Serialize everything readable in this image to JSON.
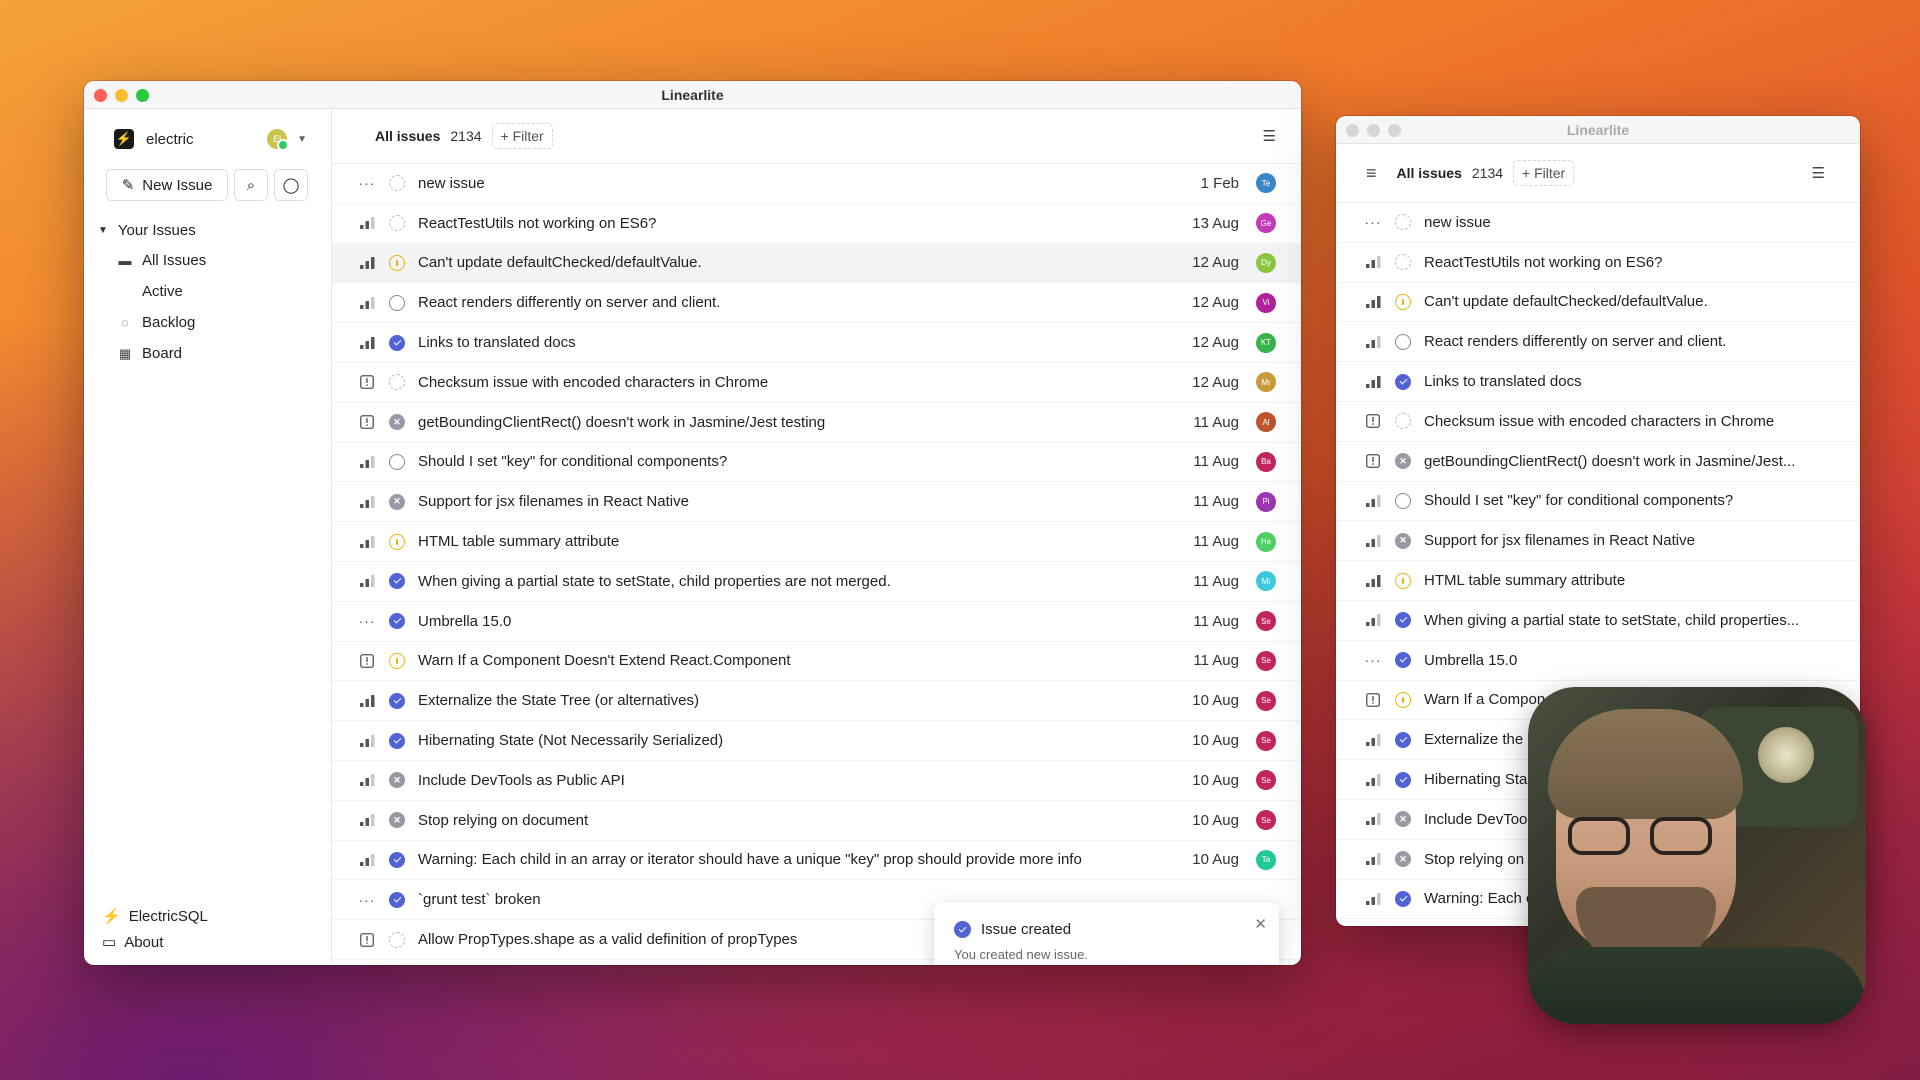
{
  "app_title": "Linearlite",
  "sidebar": {
    "workspace": "electric",
    "avatar_initials": "El",
    "new_issue": "New Issue",
    "group": "Your Issues",
    "items": [
      {
        "label": "All Issues",
        "icon": "inbox-icon"
      },
      {
        "label": "Active",
        "icon": ""
      },
      {
        "label": "Backlog",
        "icon": "backlog-circle-icon"
      },
      {
        "label": "Board",
        "icon": "grid-icon"
      }
    ],
    "footer": [
      {
        "label": "ElectricSQL",
        "icon": "bolt-icon"
      },
      {
        "label": "About",
        "icon": "info-icon"
      }
    ]
  },
  "topbar": {
    "title": "All issues",
    "count": "2134",
    "filter": "+ Filter"
  },
  "colors": {
    "done": "#5263d5",
    "in_progress": "#e8b40c",
    "canceled": "#9a9aa6"
  },
  "issues": [
    {
      "prio": "none",
      "status": "backlog",
      "title": "new issue",
      "date": "1 Feb",
      "avatar": "Te",
      "color": "#3a86c8"
    },
    {
      "prio": "med",
      "status": "backlog",
      "title": "ReactTestUtils not working on ES6?",
      "date": "13 Aug",
      "avatar": "Ge",
      "color": "#c23bb6"
    },
    {
      "prio": "high",
      "status": "progress",
      "title": "Can't update defaultChecked/defaultValue.",
      "date": "12 Aug",
      "avatar": "Dy",
      "color": "#8cc63f"
    },
    {
      "prio": "med",
      "status": "todo",
      "title": "React renders differently on server and client.",
      "date": "12 Aug",
      "avatar": "Vi",
      "color": "#b0219a"
    },
    {
      "prio": "high",
      "status": "done",
      "title": "Links to translated docs",
      "date": "12 Aug",
      "avatar": "KT",
      "color": "#37b24d"
    },
    {
      "prio": "urgent",
      "status": "backlog",
      "title": "Checksum issue with encoded characters in Chrome",
      "date": "12 Aug",
      "avatar": "Mr",
      "color": "#c89a3a"
    },
    {
      "prio": "urgent",
      "status": "cancel",
      "title": "getBoundingClientRect() doesn't work in Jasmine/Jest testing",
      "date": "11 Aug",
      "avatar": "Al",
      "color": "#c0542d"
    },
    {
      "prio": "med",
      "status": "todo",
      "title": "Should I set \"key\" for conditional components?",
      "date": "11 Aug",
      "avatar": "Ba",
      "color": "#c2255c"
    },
    {
      "prio": "med",
      "status": "cancel",
      "title": "Support for jsx filenames in React Native",
      "date": "11 Aug",
      "avatar": "Pi",
      "color": "#9c36b5"
    },
    {
      "prio": "med",
      "status": "progress",
      "title": "HTML table summary attribute",
      "date": "11 Aug",
      "avatar": "He",
      "color": "#51cf66"
    },
    {
      "prio": "med",
      "status": "done",
      "title": "When giving a partial state to setState, child properties are not merged.",
      "date": "11 Aug",
      "avatar": "Mi",
      "color": "#3bc9db"
    },
    {
      "prio": "none",
      "status": "done",
      "title": "Umbrella 15.0",
      "date": "11 Aug",
      "avatar": "Se",
      "color": "#c2255c"
    },
    {
      "prio": "urgent",
      "status": "progress",
      "title": "Warn If a Component Doesn't Extend React.Component",
      "date": "11 Aug",
      "avatar": "Se",
      "color": "#c2255c"
    },
    {
      "prio": "high",
      "status": "done",
      "title": "Externalize the State Tree (or alternatives)",
      "date": "10 Aug",
      "avatar": "Se",
      "color": "#c2255c"
    },
    {
      "prio": "med",
      "status": "done",
      "title": "Hibernating State (Not Necessarily Serialized)",
      "date": "10 Aug",
      "avatar": "Se",
      "color": "#c2255c"
    },
    {
      "prio": "med",
      "status": "cancel",
      "title": "Include DevTools as Public API",
      "date": "10 Aug",
      "avatar": "Se",
      "color": "#c2255c"
    },
    {
      "prio": "med",
      "status": "cancel",
      "title": "Stop relying on document",
      "date": "10 Aug",
      "avatar": "Se",
      "color": "#c2255c"
    },
    {
      "prio": "med",
      "status": "done",
      "title": "Warning: Each child in an array or iterator should have a unique \"key\" prop should provide more info",
      "date": "10 Aug",
      "avatar": "Ta",
      "color": "#20c997"
    },
    {
      "prio": "none",
      "status": "done",
      "title": "`grunt test` broken",
      "date": "",
      "avatar": "",
      "color": ""
    },
    {
      "prio": "urgent",
      "status": "backlog",
      "title": "Allow PropTypes.shape as a valid definition of propTypes",
      "date": "",
      "avatar": "",
      "color": ""
    }
  ],
  "issues2": [
    {
      "prio": "none",
      "status": "backlog",
      "title": "new issue"
    },
    {
      "prio": "med",
      "status": "backlog",
      "title": "ReactTestUtils not working on ES6?"
    },
    {
      "prio": "high",
      "status": "progress",
      "title": "Can't update defaultChecked/defaultValue."
    },
    {
      "prio": "med",
      "status": "todo",
      "title": "React renders differently on server and client."
    },
    {
      "prio": "high",
      "status": "done",
      "title": "Links to translated docs"
    },
    {
      "prio": "urgent",
      "status": "backlog",
      "title": "Checksum issue with encoded characters in Chrome"
    },
    {
      "prio": "urgent",
      "status": "cancel",
      "title": "getBoundingClientRect() doesn't work in Jasmine/Jest..."
    },
    {
      "prio": "med",
      "status": "todo",
      "title": "Should I set \"key\" for conditional components?"
    },
    {
      "prio": "med",
      "status": "cancel",
      "title": "Support for jsx filenames in React Native"
    },
    {
      "prio": "high",
      "status": "progress",
      "title": "HTML table summary attribute"
    },
    {
      "prio": "med",
      "status": "done",
      "title": "When giving a partial state to setState, child properties..."
    },
    {
      "prio": "none",
      "status": "done",
      "title": "Umbrella 15.0"
    },
    {
      "prio": "urgent",
      "status": "progress",
      "title": "Warn If a Compone"
    },
    {
      "prio": "med",
      "status": "done",
      "title": "Externalize the S"
    },
    {
      "prio": "med",
      "status": "done",
      "title": "Hibernating Sta"
    },
    {
      "prio": "med",
      "status": "cancel",
      "title": "Include DevToo"
    },
    {
      "prio": "med",
      "status": "cancel",
      "title": "Stop relying on"
    },
    {
      "prio": "med",
      "status": "done",
      "title": "Warning: Each c"
    }
  ],
  "toast": {
    "title": "Issue created",
    "message": "You created new issue."
  }
}
